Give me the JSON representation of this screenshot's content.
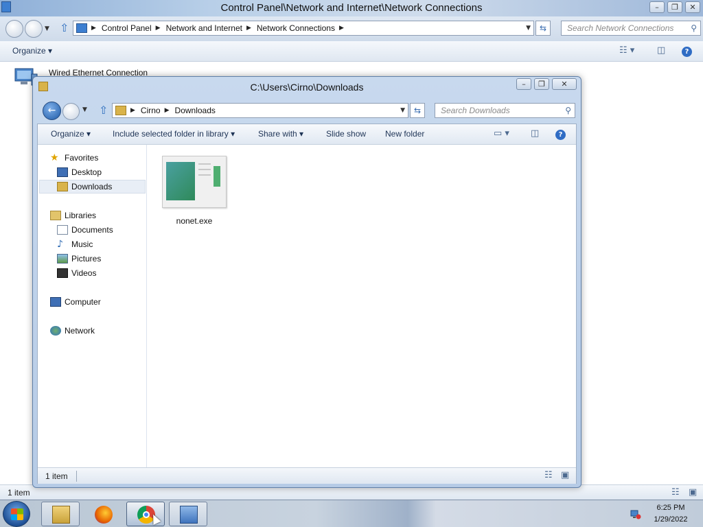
{
  "background_window": {
    "title": "Control Panel\\Network and Internet\\Network Connections",
    "breadcrumbs": [
      "Control Panel",
      "Network and Internet",
      "Network Connections"
    ],
    "search_placeholder": "Search Network Connections",
    "toolbar": {
      "organize_label": "Organize"
    },
    "connection": {
      "name": "Wired Ethernet Connection"
    },
    "status_text": "1 item"
  },
  "foreground_window": {
    "title": "C:\\Users\\Cirno\\Downloads",
    "breadcrumbs": [
      "Cirno",
      "Downloads"
    ],
    "search_placeholder": "Search Downloads",
    "toolbar": {
      "organize_label": "Organize",
      "include_label": "Include selected folder in library",
      "share_label": "Share with",
      "slideshow_label": "Slide show",
      "newfolder_label": "New folder"
    },
    "nav": {
      "favorites": "Favorites",
      "desktop": "Desktop",
      "downloads": "Downloads",
      "libraries": "Libraries",
      "documents": "Documents",
      "music": "Music",
      "pictures": "Pictures",
      "videos": "Videos",
      "computer": "Computer",
      "network": "Network"
    },
    "files": [
      {
        "name": "nonet.exe"
      }
    ],
    "status_text": "1 item"
  },
  "taskbar": {
    "apps": [
      "Windows Explorer",
      "Firefox",
      "Chrome",
      "Control Panel"
    ],
    "clock_time": "6:25 PM",
    "clock_date": "1/29/2022"
  },
  "colors": {
    "accent": "#2f6cc4",
    "titlebar": "#c8d9ee",
    "selection": "#e8eef6"
  }
}
